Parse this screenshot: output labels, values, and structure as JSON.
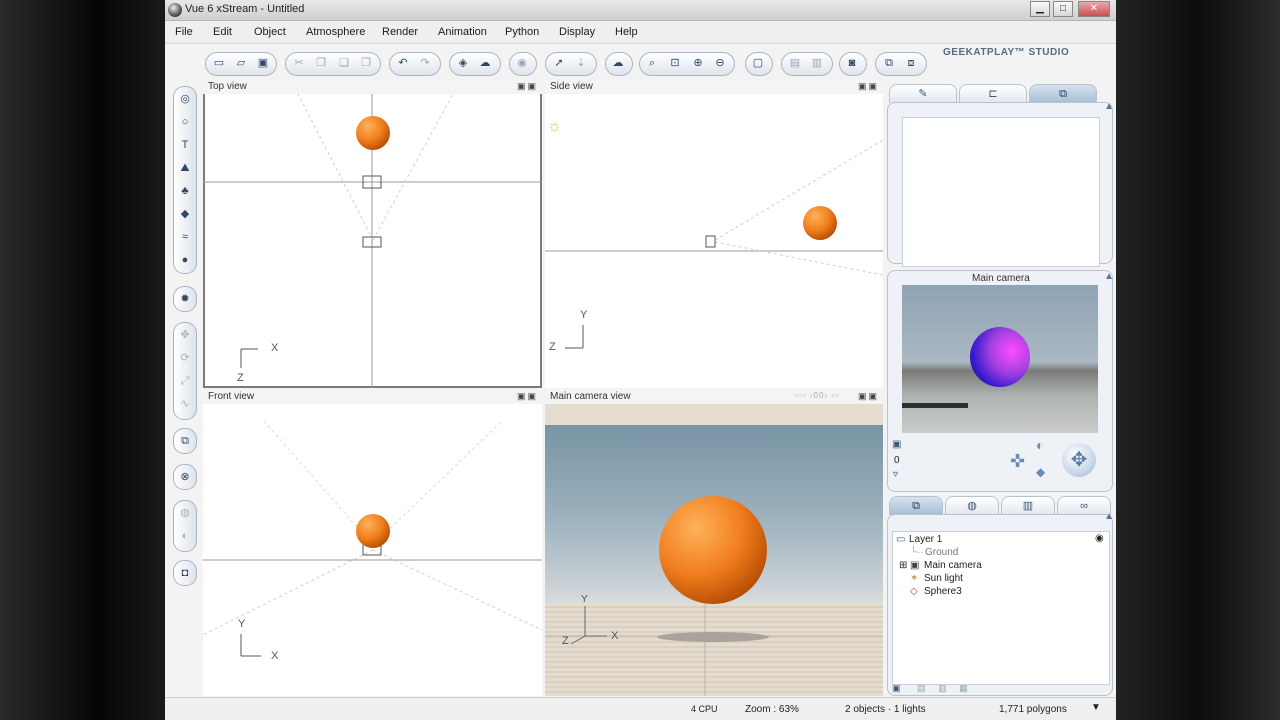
{
  "window": {
    "title": "Vue 6 xStream - Untitled",
    "min_label": "▁",
    "max_label": "□",
    "close_label": "✕"
  },
  "menu": [
    "File",
    "Edit",
    "Object",
    "Atmosphere",
    "Render",
    "Animation",
    "Python",
    "Display",
    "Help"
  ],
  "brand": "GEEKATPLAY™ STUDIO",
  "viewports": {
    "top": {
      "title": "Top view",
      "axis_x": "X",
      "axis_y": "Z"
    },
    "side": {
      "title": "Side view",
      "axis_x": "Z",
      "axis_y": "Y"
    },
    "front": {
      "title": "Front view",
      "axis_x": "X",
      "axis_y": "Y"
    },
    "camera": {
      "title": "Main camera view",
      "axis_x": "X",
      "axis_y": "Y",
      "axis_z": "Z"
    }
  },
  "camera_panel": {
    "title": "Main camera",
    "frame_value": "0"
  },
  "layers": {
    "layer_name": "Layer 1",
    "items": [
      "Ground",
      "Main camera",
      "Sun light",
      "Sphere3"
    ]
  },
  "status": {
    "cpu": "4 CPU",
    "zoom": "Zoom : 63%",
    "objects": "2 objects · 1 lights",
    "polygons": "1,771 polygons"
  },
  "colors": {
    "sphere": "#f07d1d",
    "sky": "#8fa9b7",
    "ground": "#e1d8c9",
    "accent": "#3b5677"
  },
  "icons": {
    "toolbar": [
      "new-file-icon",
      "open-file-icon",
      "save-icon",
      "cut-icon",
      "copy-icon",
      "paste-icon",
      "duplicate-icon",
      "undo-icon",
      "redo-icon",
      "render-icon",
      "cloud-render-icon",
      "atmosphere-icon",
      "select-icon",
      "drop-icon",
      "clouds-icon",
      "zoom-region-icon",
      "zoom-fit-icon",
      "zoom-in-icon",
      "zoom-out-icon",
      "single-view-icon",
      "layout-icon",
      "layout-2-icon",
      "camera-icon",
      "render-area-icon",
      "render-preview-icon"
    ],
    "left_tools": [
      "sphere-icon",
      "torus-icon",
      "text-icon",
      "terrain-icon",
      "plant-icon",
      "rock-icon",
      "water-icon",
      "ecosystem-icon",
      "light-icon",
      "move-icon",
      "rotate-icon",
      "scale-icon",
      "twist-icon",
      "group-icon",
      "boolean-icon",
      "metablob-icon",
      "cut-plane-icon",
      "camera-tool-icon"
    ]
  }
}
